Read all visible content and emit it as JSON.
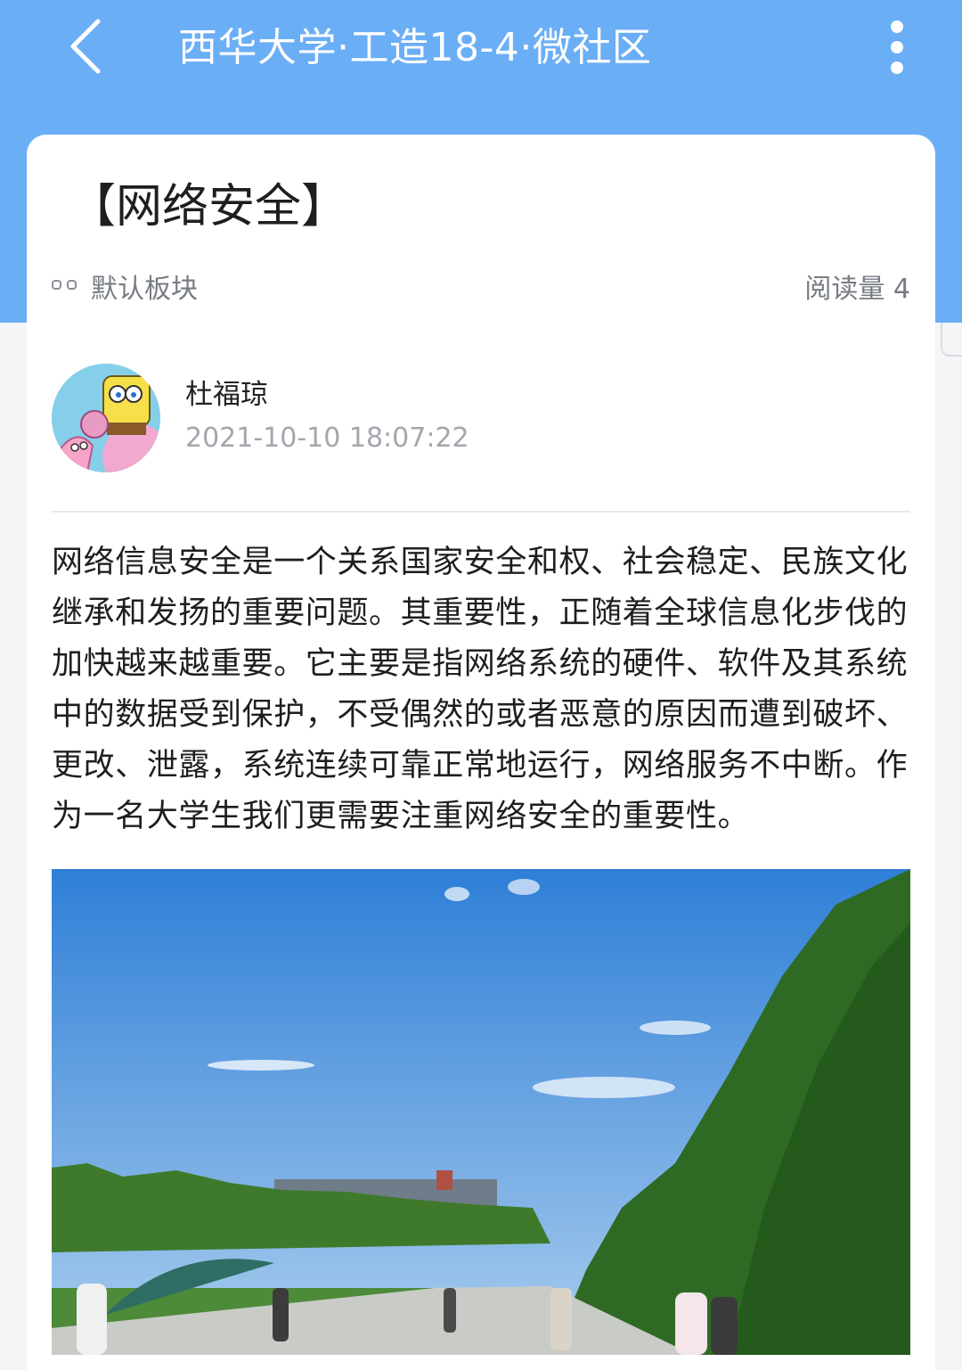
{
  "header": {
    "title": "西华大学·工造18-4·微社区"
  },
  "post": {
    "title": "【网络安全】",
    "board": "默认板块",
    "read_count": "阅读量 4",
    "author": {
      "name": "杜福琼",
      "time": "2021-10-10 18:07:22"
    },
    "content": "网络信息安全是一个关系国家安全和权、社会稳定、民族文化继承和发扬的重要问题。其重要性，正随着全球信息化步伐的加快越来越重要。它主要是指网络系统的硬件、软件及其系统中的数据受到保护，不受偶然的或者恶意的原因而遭到破坏、更改、泄露，系统连续可靠正常地运行，网络服务不中断。作为一名大学生我们更需要注重网络安全的重要性。"
  },
  "icons": {
    "back": "chevron-left-icon",
    "more": "more-vertical-icon",
    "board": "board-icon"
  },
  "colors": {
    "header": "#6aaef6",
    "card": "#ffffff",
    "text": "#1e1e1e",
    "muted": "#777b83"
  }
}
